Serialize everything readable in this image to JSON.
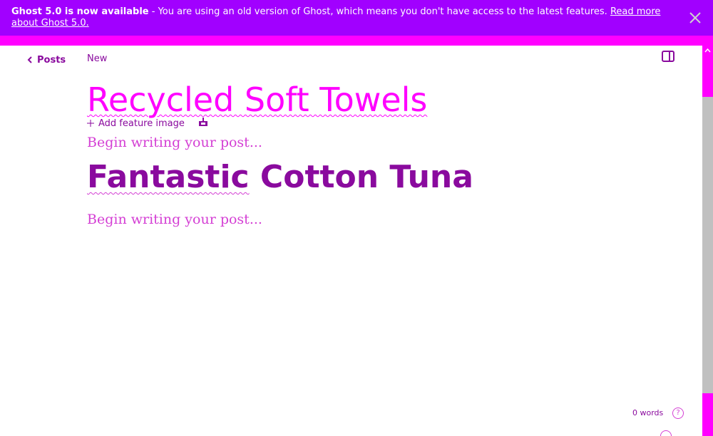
{
  "banner": {
    "bold_text": "Ghost 5.0 is now available",
    "body_text": " - You are using an old version of Ghost, which means you don't have access to the latest features. ",
    "link_text": "Read more about Ghost 5.0."
  },
  "nav": {
    "back_label": "Posts",
    "status": "New"
  },
  "editor": {
    "title": "Recycled Soft Towels",
    "add_feature_image": "Add feature image",
    "paragraph_1": "Begin writing your post...",
    "heading_word_1": "Fantastic",
    "heading_rest": " Cotton Tuna",
    "paragraph_2": "Begin writing your post..."
  },
  "footer": {
    "word_count": "0 words",
    "help_glyph": "?"
  },
  "colors": {
    "banner_bg": "#a100ff",
    "accent": "#ff00ff",
    "text": "#8a0a9e",
    "muted": "#d43fd4"
  },
  "icons": [
    "close-icon",
    "chevron-left-icon",
    "sidebar-toggle-icon",
    "plus-icon",
    "upload-icon",
    "help-icon"
  ]
}
